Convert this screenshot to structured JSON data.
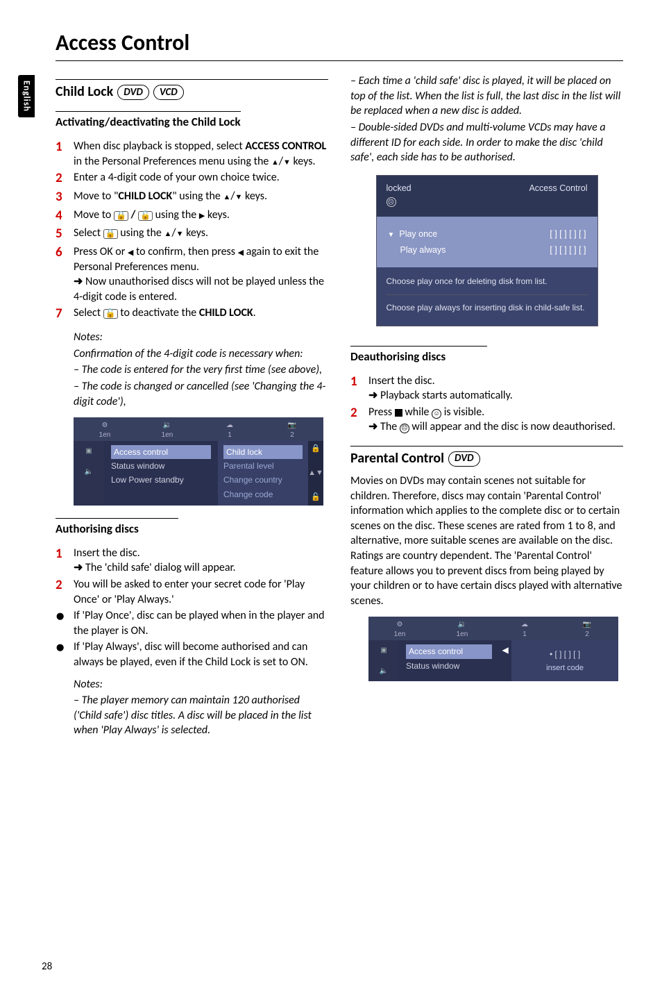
{
  "page": {
    "title": "Access Control",
    "lang_tab": "English",
    "number": "28"
  },
  "col1": {
    "child_lock": {
      "heading": "Child Lock",
      "pill_dvd": "DVD",
      "pill_vcd": "VCD"
    },
    "activating": {
      "heading": "Activating/deactivating the Child Lock",
      "s1a": "When disc playback is stopped, select ",
      "s1b": "ACCESS CONTROL",
      "s1c": " in the Personal Preferences menu using the ",
      "s1d": " keys.",
      "s2": "Enter a 4-digit code of your own choice twice.",
      "s3a": "Move to \"",
      "s3b": "CHILD LOCK",
      "s3c": "\" using the ",
      "s3d": " keys.",
      "s4a": "Move to ",
      "s4b": " using the ",
      "s4c": " keys.",
      "s5a": "Select ",
      "s5b": " using the ",
      "s5c": " keys.",
      "s6a": "Press OK or ",
      "s6b": " to confirm, then press ",
      "s6c": " again to exit the Personal Preferences menu.",
      "s6d": "Now unauthorised discs will not be played unless the 4-digit code is entered.",
      "s7a": "Select ",
      "s7b": " to deactivate the ",
      "s7c": "CHILD LOCK",
      "s7d": ".",
      "notes_label": "Notes:",
      "note1": "Confirmation of the 4-digit code is necessary when:",
      "note2": "–   The code is entered for the very first time (see above),",
      "note3": "–   The code is changed or cancelled (see 'Changing the 4-digit code'),"
    },
    "osd1": {
      "tabs": [
        "1en",
        "1en",
        "1",
        "2"
      ],
      "mid": [
        "Access control",
        "Status window",
        "Low Power standby"
      ],
      "right": [
        "Child lock",
        "Parental level",
        "Change country",
        "Change code"
      ]
    },
    "authorising": {
      "heading": "Authorising discs",
      "s1": "Insert the disc.",
      "s1b": "The 'child safe' dialog will appear.",
      "s2": "You will be asked to enter your secret code for 'Play Once' or 'Play Always.'",
      "b1": "If 'Play Once', disc can be played when in the player and the player is ON.",
      "b2": "If 'Play Always', disc will become authorised and can always be played, even if the Child Lock is set to ON.",
      "notes_label": "Notes:",
      "note1": "–   The player memory can maintain 120 authorised ('Child safe') disc titles. A disc will be placed in the list when 'Play Always' is selected."
    }
  },
  "col2": {
    "cont_notes": {
      "n1": "–   Each time a 'child safe' disc is played, it will be placed on top of the list. When the list is full, the last disc in the list will be replaced when a new disc is added.",
      "n2": "–   Double-sided DVDs and multi-volume VCDs may have a different ID for each side. In order to make the disc 'child safe', each side has to be authorised."
    },
    "dialog": {
      "locked": "locked",
      "title_right": "Access Control",
      "playonce": "Play once",
      "playalways": "Play always",
      "code_blank": "[ ]  [ ]  [ ]  [ ]",
      "foot1": "Choose play once for deleting disk from list.",
      "foot2": "Choose play always for inserting disk in child-safe list."
    },
    "deauth": {
      "heading": "Deauthorising discs",
      "s1": "Insert the disc.",
      "s1b": "Playback starts automatically.",
      "s2a": "Press ",
      "s2b": " while ",
      "s2c": " is visible.",
      "s2d": "The ",
      "s2e": " will appear and the disc is now deauthorised."
    },
    "parental": {
      "heading": "Parental Control",
      "pill": "DVD",
      "para": "Movies on DVDs may contain scenes not suitable for children. Therefore, discs may contain 'Parental Control' information which applies to the complete disc or to certain scenes on the disc. These scenes are rated from 1 to 8, and alternative, more suitable scenes are available on the disc. Ratings are country dependent. The 'Parental Control' feature allows you to prevent discs from being played by your children or to have certain discs played with alternative scenes."
    },
    "osd2": {
      "tabs": [
        "1en",
        "1en",
        "1",
        "2"
      ],
      "mid": [
        "Access control",
        "Status window"
      ],
      "code": "•  [ ]  [ ]  [ ]",
      "hint": "insert code"
    }
  }
}
